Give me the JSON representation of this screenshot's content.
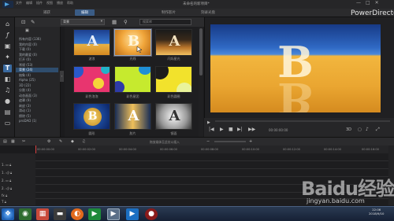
{
  "app": {
    "window_title": "未命名的新项目*",
    "brand": "PowerDirector",
    "menus": [
      "文件",
      "编辑",
      "插件",
      "视图",
      "播放",
      "帮助"
    ],
    "window_controls": [
      "—",
      "□",
      "✕"
    ]
  },
  "mode_tabs": [
    {
      "label": "捕获",
      "active": false
    },
    {
      "label": "编辑",
      "active": true
    },
    {
      "label": "制作影片",
      "active": false
    },
    {
      "label": "刻录光盘",
      "active": false
    }
  ],
  "left_strip_icons": [
    "import-icon",
    "fx-icon",
    "pip-icon",
    "particle-icon",
    "title-icon",
    "transition-icon",
    "audio-mixer-icon",
    "voiceover-icon",
    "chapter-icon",
    "subtitle-icon"
  ],
  "library": {
    "dropdown_value": "背景",
    "search_placeholder": "搜索库",
    "categories": [
      {
        "label": "所有内容 (136)",
        "selected": false
      },
      {
        "label": "我的内容 (0)",
        "selected": false
      },
      {
        "label": "下载 (0)",
        "selected": false
      },
      {
        "label": "我的最爱 (0)",
        "selected": false
      },
      {
        "label": "打开 (0)",
        "selected": false
      },
      {
        "label": "常规 (53)",
        "selected": false
      },
      {
        "label": "背景 (24)",
        "selected": true
      },
      {
        "label": "抽象 (4)",
        "selected": false
      },
      {
        "label": "Alpha (25)",
        "selected": false
      },
      {
        "label": "3D (22)",
        "selected": false
      },
      {
        "label": "分割 (4)",
        "selected": false
      },
      {
        "label": "动态画面 (3)",
        "selected": false
      },
      {
        "label": "遮罩 (9)",
        "selected": false
      },
      {
        "label": "剥皮 (3)",
        "selected": false
      },
      {
        "label": "滑动 (1)",
        "selected": false
      },
      {
        "label": "擦除 (5)",
        "selected": false
      },
      {
        "label": "proDAD (1)",
        "selected": false
      }
    ],
    "thumbnails": [
      {
        "caption": "波浪",
        "letter": "A",
        "selected": false
      },
      {
        "caption": "光线",
        "letter": "B",
        "selected": true
      },
      {
        "caption": "闪烁星光",
        "letter": "A",
        "selected": false
      },
      {
        "caption": "彩色泡泡",
        "letter": "",
        "selected": false
      },
      {
        "caption": "彩色星团",
        "letter": "",
        "selected": false
      },
      {
        "caption": "彩色圆圈",
        "letter": "",
        "selected": false
      },
      {
        "caption": "圆形",
        "letter": "B",
        "selected": false
      },
      {
        "caption": "胶片",
        "letter": "A",
        "selected": false
      },
      {
        "caption": "镜面",
        "letter": "A",
        "selected": false
      }
    ]
  },
  "preview": {
    "letter": "B",
    "controls": [
      "prev-frame-icon",
      "play-icon",
      "stop-icon",
      "next-frame-icon",
      "fast-forward-icon"
    ],
    "timecode": "00:00:00:00",
    "badges": [
      "3D",
      "▢"
    ]
  },
  "timeline": {
    "toolbar_hint": "拖放媒体至此处以插入",
    "ruler": [
      "00:00:00:00",
      "00:00:02:00",
      "00:00:04:00",
      "00:00:06:00",
      "00:00:08:00",
      "00:00:10:00",
      "00:00:12:00",
      "00:00:14:00",
      "00:00:16:00"
    ],
    "tracks": [
      {
        "label": "1.",
        "icon": "video-track-icon"
      },
      {
        "label": "1.",
        "icon": "audio-track-icon"
      },
      {
        "label": "2.",
        "icon": "video-track-icon"
      },
      {
        "label": "2.",
        "icon": "audio-track-icon"
      },
      {
        "label": "fx",
        "icon": "effect-track-icon"
      },
      {
        "label": "T",
        "icon": "title-track-icon"
      }
    ]
  },
  "taskbar": {
    "time": "22:06",
    "date": "2018/9/10"
  },
  "watermark": {
    "logo": "Baidu经验",
    "url": "jingyan.baidu.com"
  }
}
